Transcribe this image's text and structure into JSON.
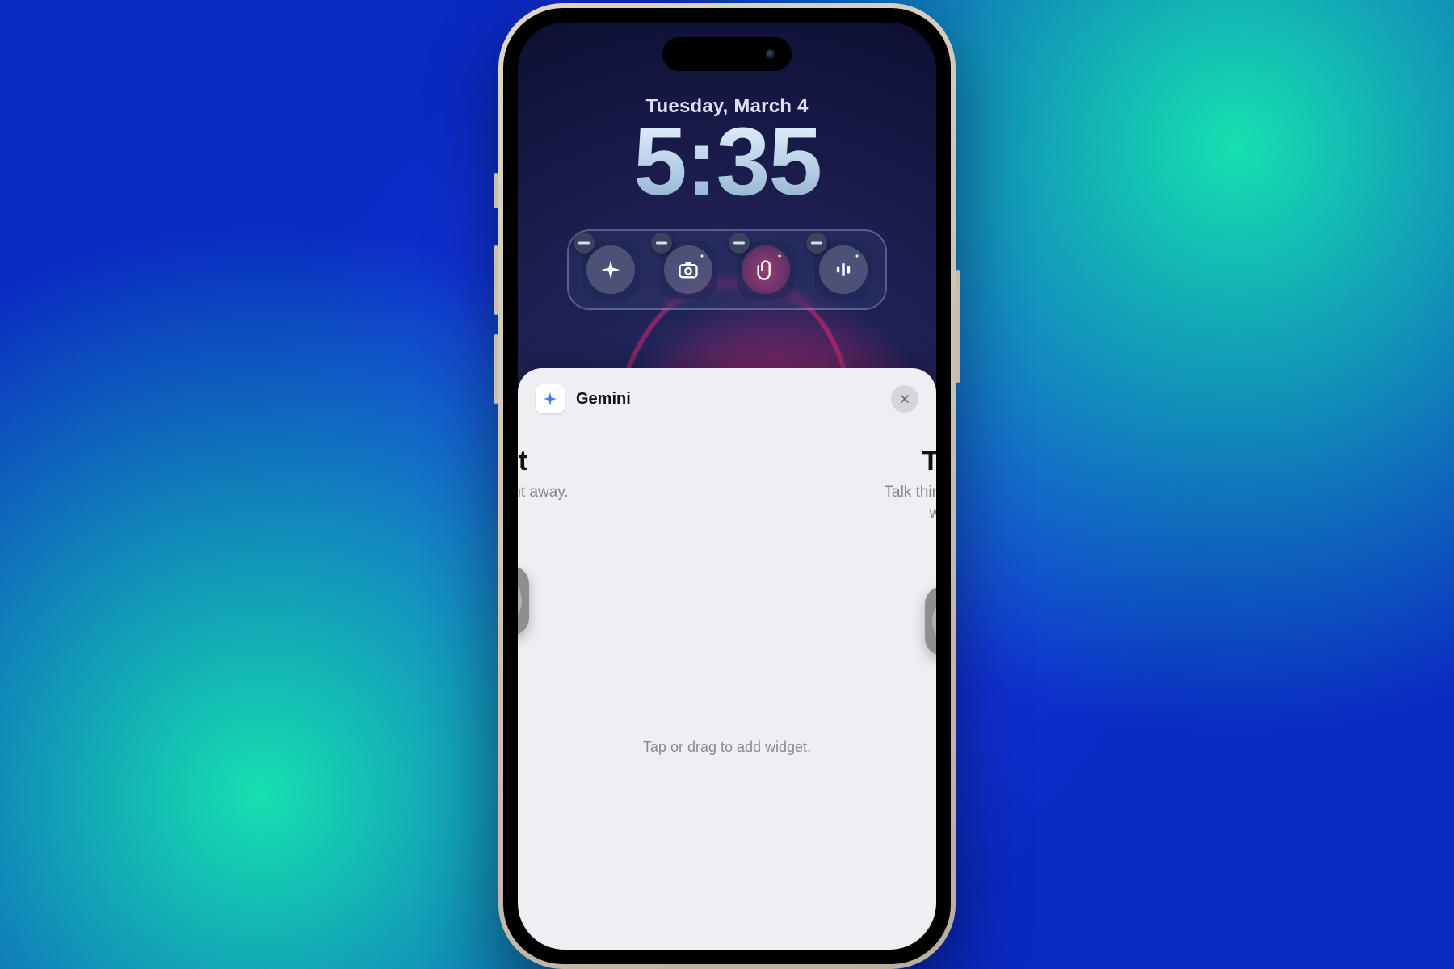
{
  "lockscreen": {
    "date": "Tuesday, March 4",
    "time": "5:35",
    "widgets": [
      {
        "id": "sparkle",
        "tinted": false
      },
      {
        "id": "camera",
        "tinted": false
      },
      {
        "id": "attach",
        "tinted": true
      },
      {
        "id": "voice",
        "tinted": false
      }
    ]
  },
  "sheet": {
    "app_name": "Gemini",
    "hint": "Tap or drag to add widget.",
    "cards": [
      {
        "title_fragment": "ompt",
        "subtitle_fragment": "e anything right away.",
        "widget_icon": "sparkle"
      },
      {
        "title_fragment": "Talk L",
        "subtitle_line1": "Talk things through, or",
        "subtitle_line2": "with Gen",
        "widget_icon": "voice"
      }
    ]
  },
  "colors": {
    "bg_teal": "#16e0b0",
    "bg_blue": "#1b3df4",
    "accent_pink": "#ff2878"
  }
}
